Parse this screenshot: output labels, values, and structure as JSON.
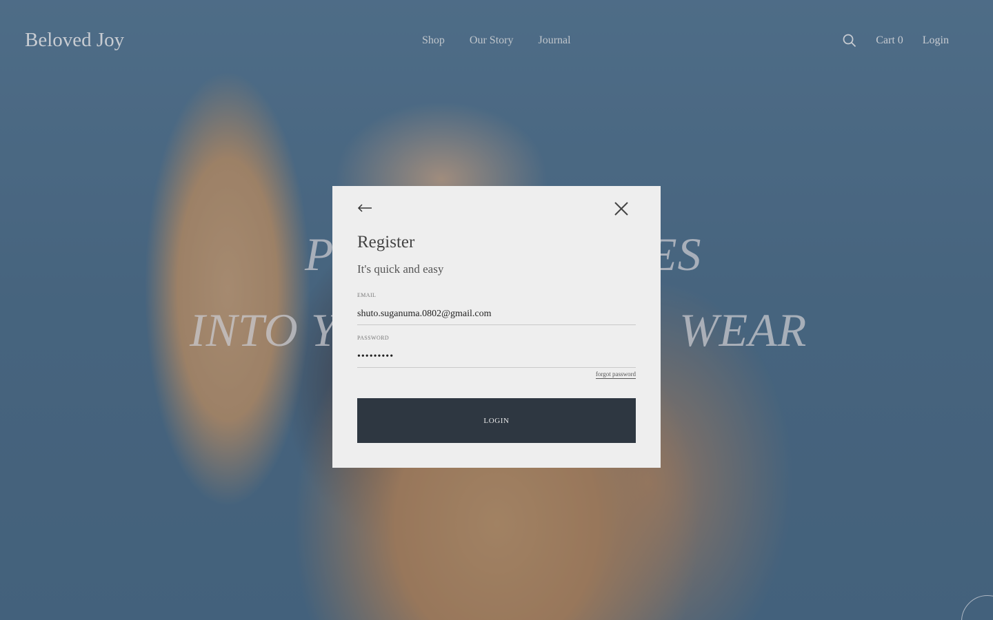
{
  "header": {
    "brand": "Beloved Joy",
    "nav": [
      "Shop",
      "Our Story",
      "Journal"
    ],
    "cart_label": "Cart 0",
    "login_label": "Login"
  },
  "hero": {
    "line1_left": "P",
    "line1_right": "ES",
    "line2_left": "INTO Y",
    "line2_right": "WEAR"
  },
  "modal": {
    "title": "Register",
    "subtitle": "It's quick and easy",
    "email_label": "EMAIL",
    "email_value": "shuto.suganuma.0802@gmail.com",
    "password_label": "PASSWORD",
    "password_value": "•••••••••",
    "forgot_label": "forgot password",
    "submit_label": "LOGIN"
  },
  "colors": {
    "button_bg": "#2e3741",
    "modal_bg": "#eeeeee"
  }
}
